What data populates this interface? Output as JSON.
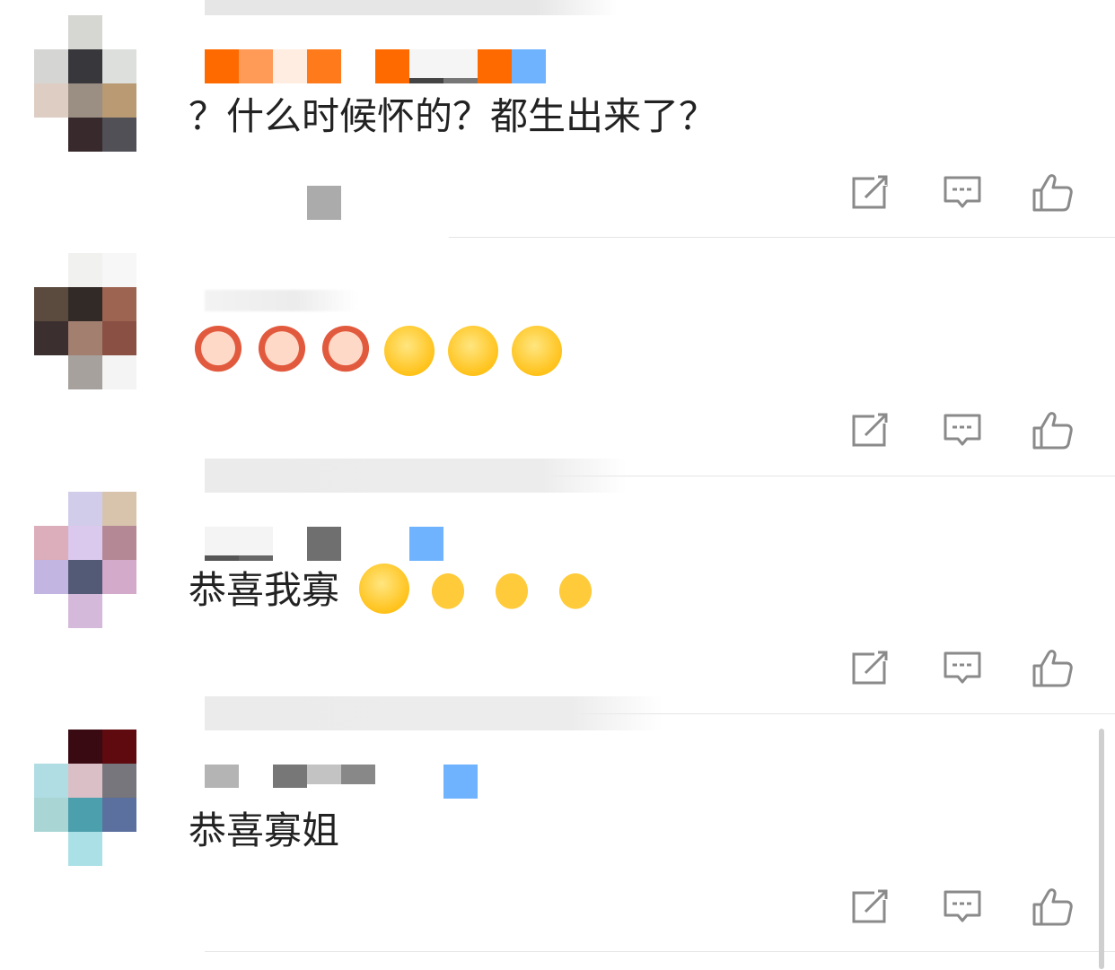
{
  "comments": [
    {
      "text": "？什么时候怀的？都生出来了？",
      "emojis": []
    },
    {
      "text": "",
      "emojis": [
        "cartoon-person-emoji",
        "cartoon-person-emoji",
        "cartoon-person-emoji",
        "praying-smile-emoji",
        "praying-smile-emoji",
        "praying-smile-emoji"
      ]
    },
    {
      "text": "恭喜我寡",
      "emojis": [
        "blushing-smile-emoji",
        "clapping-hands-emoji",
        "clapping-hands-emoji",
        "clapping-hands-emoji"
      ]
    },
    {
      "text": "恭喜寡姐",
      "emojis": []
    }
  ],
  "actions": {
    "share_icon": "share-icon",
    "reply_icon": "comment-icon",
    "like_icon": "thumbs-up-icon"
  },
  "colors": {
    "text": "#222222",
    "icon": "#8a8a8a",
    "divider": "#e5e5e5",
    "vip_orange": "#ff7a12",
    "vip_blue": "#6fb3ff"
  }
}
